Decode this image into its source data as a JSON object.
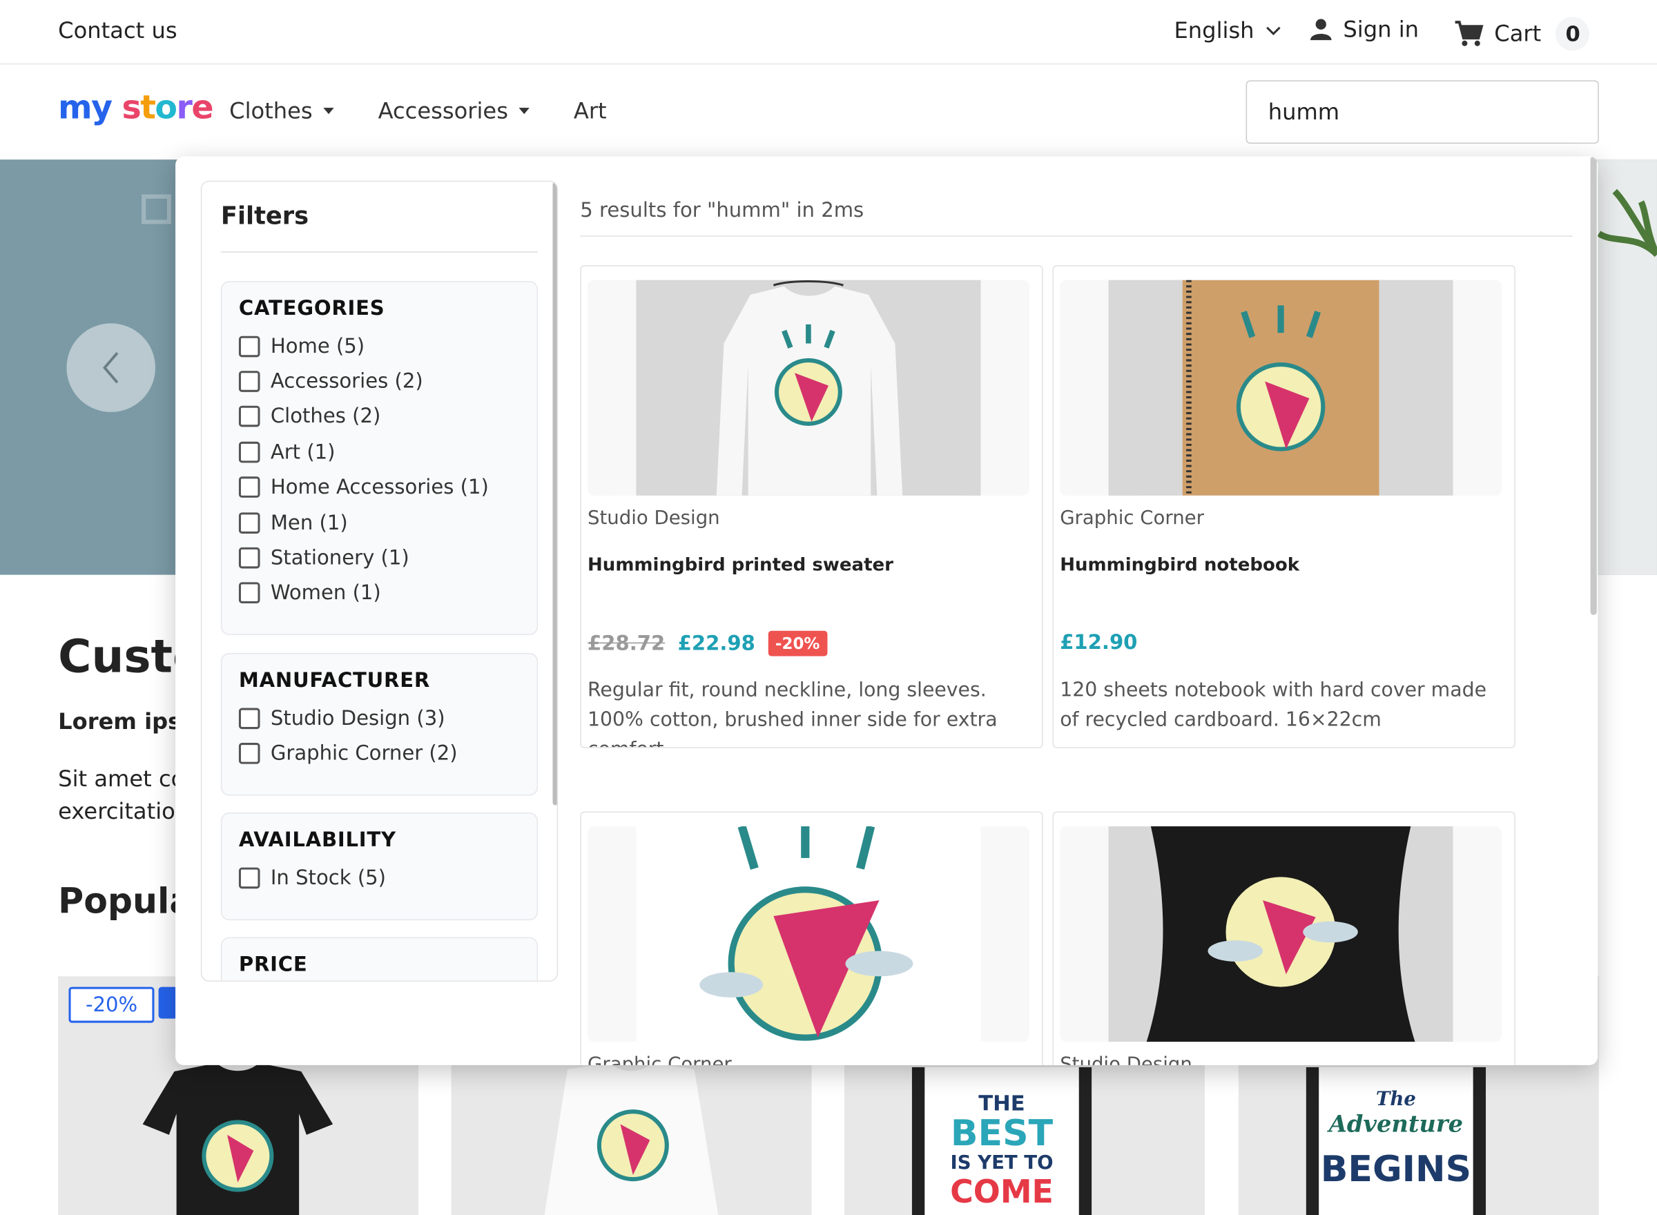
{
  "topbar": {
    "contact": "Contact us",
    "language": "English",
    "sign_in": "Sign in",
    "cart": "Cart",
    "cart_count": "0"
  },
  "header": {
    "logo": "my store",
    "nav": [
      "Clothes",
      "Accessories",
      "Art"
    ],
    "search_value": "humm"
  },
  "page": {
    "heading": "Custo",
    "lorem": "Lorem ipsu",
    "para_line1": "Sit amet co",
    "para_line2": "exercitatior",
    "popular": "Popular",
    "badge": "-20%",
    "posters": [
      {
        "l1": "THE",
        "l2": "BEST",
        "l3": "IS YET TO",
        "l4": "COME"
      },
      {
        "l1": "The",
        "l2": "Adventure",
        "l3": "",
        "l4": "BEGINS"
      }
    ]
  },
  "filters": {
    "title": "Filters",
    "groups": [
      {
        "title": "CATEGORIES",
        "options": [
          "Home (5)",
          "Accessories (2)",
          "Clothes (2)",
          "Art (1)",
          "Home Accessories (1)",
          "Men (1)",
          "Stationery (1)",
          "Women (1)"
        ]
      },
      {
        "title": "MANUFACTURER",
        "options": [
          "Studio Design (3)",
          "Graphic Corner (2)"
        ]
      },
      {
        "title": "AVAILABILITY",
        "options": [
          "In Stock (5)"
        ]
      },
      {
        "title": "PRICE",
        "options": []
      }
    ]
  },
  "results": {
    "summary": "5 results for \"humm\" in 2ms",
    "items": [
      {
        "brand": "Studio Design",
        "name": "Hummingbird printed sweater",
        "old_price": "£28.72",
        "price": "£22.98",
        "discount": "-20%",
        "description": "Regular fit, round neckline, long sleeves. 100% cotton, brushed inner side for extra comfort.",
        "image": "sweater-image"
      },
      {
        "brand": "Graphic Corner",
        "name": "Hummingbird notebook",
        "old_price": "",
        "price": "£12.90",
        "discount": "",
        "description": "120 sheets notebook with hard cover made of recycled cardboard. 16×22cm",
        "image": "notebook-image"
      },
      {
        "brand": "Graphic Corner",
        "name": "",
        "old_price": "",
        "price": "",
        "discount": "",
        "description": "",
        "image": "poster-image"
      },
      {
        "brand": "Studio Design",
        "name": "",
        "old_price": "",
        "price": "",
        "discount": "",
        "description": "",
        "image": "cushion-image"
      }
    ]
  },
  "colors": {
    "accent": "#1ea0b4",
    "discount": "#ef5350",
    "hero": "#7b9aa6",
    "badge_blue": "#2563eb"
  }
}
